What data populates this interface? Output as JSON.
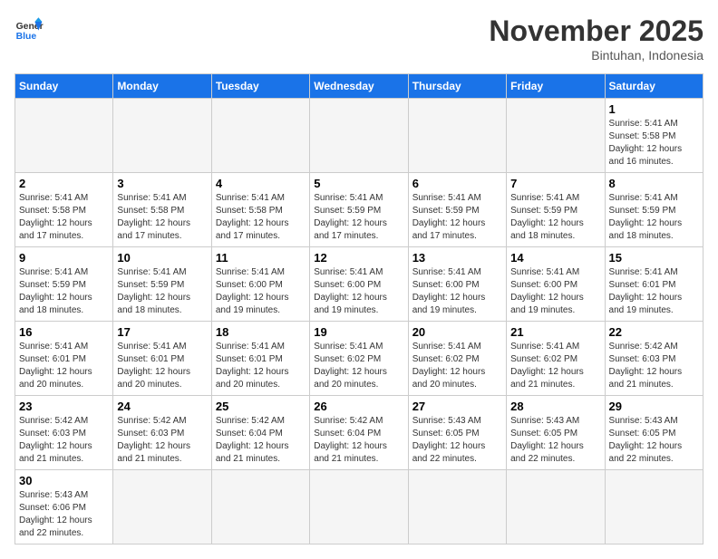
{
  "header": {
    "logo_general": "General",
    "logo_blue": "Blue",
    "month_title": "November 2025",
    "subtitle": "Bintuhan, Indonesia"
  },
  "weekdays": [
    "Sunday",
    "Monday",
    "Tuesday",
    "Wednesday",
    "Thursday",
    "Friday",
    "Saturday"
  ],
  "weeks": [
    [
      {
        "day": "",
        "info": "",
        "empty": true
      },
      {
        "day": "",
        "info": "",
        "empty": true
      },
      {
        "day": "",
        "info": "",
        "empty": true
      },
      {
        "day": "",
        "info": "",
        "empty": true
      },
      {
        "day": "",
        "info": "",
        "empty": true
      },
      {
        "day": "",
        "info": "",
        "empty": true
      },
      {
        "day": "1",
        "info": "Sunrise: 5:41 AM\nSunset: 5:58 PM\nDaylight: 12 hours and 16 minutes.",
        "empty": false
      }
    ],
    [
      {
        "day": "2",
        "info": "Sunrise: 5:41 AM\nSunset: 5:58 PM\nDaylight: 12 hours and 17 minutes.",
        "empty": false
      },
      {
        "day": "3",
        "info": "Sunrise: 5:41 AM\nSunset: 5:58 PM\nDaylight: 12 hours and 17 minutes.",
        "empty": false
      },
      {
        "day": "4",
        "info": "Sunrise: 5:41 AM\nSunset: 5:58 PM\nDaylight: 12 hours and 17 minutes.",
        "empty": false
      },
      {
        "day": "5",
        "info": "Sunrise: 5:41 AM\nSunset: 5:59 PM\nDaylight: 12 hours and 17 minutes.",
        "empty": false
      },
      {
        "day": "6",
        "info": "Sunrise: 5:41 AM\nSunset: 5:59 PM\nDaylight: 12 hours and 17 minutes.",
        "empty": false
      },
      {
        "day": "7",
        "info": "Sunrise: 5:41 AM\nSunset: 5:59 PM\nDaylight: 12 hours and 18 minutes.",
        "empty": false
      },
      {
        "day": "8",
        "info": "Sunrise: 5:41 AM\nSunset: 5:59 PM\nDaylight: 12 hours and 18 minutes.",
        "empty": false
      }
    ],
    [
      {
        "day": "9",
        "info": "Sunrise: 5:41 AM\nSunset: 5:59 PM\nDaylight: 12 hours and 18 minutes.",
        "empty": false
      },
      {
        "day": "10",
        "info": "Sunrise: 5:41 AM\nSunset: 5:59 PM\nDaylight: 12 hours and 18 minutes.",
        "empty": false
      },
      {
        "day": "11",
        "info": "Sunrise: 5:41 AM\nSunset: 6:00 PM\nDaylight: 12 hours and 19 minutes.",
        "empty": false
      },
      {
        "day": "12",
        "info": "Sunrise: 5:41 AM\nSunset: 6:00 PM\nDaylight: 12 hours and 19 minutes.",
        "empty": false
      },
      {
        "day": "13",
        "info": "Sunrise: 5:41 AM\nSunset: 6:00 PM\nDaylight: 12 hours and 19 minutes.",
        "empty": false
      },
      {
        "day": "14",
        "info": "Sunrise: 5:41 AM\nSunset: 6:00 PM\nDaylight: 12 hours and 19 minutes.",
        "empty": false
      },
      {
        "day": "15",
        "info": "Sunrise: 5:41 AM\nSunset: 6:01 PM\nDaylight: 12 hours and 19 minutes.",
        "empty": false
      }
    ],
    [
      {
        "day": "16",
        "info": "Sunrise: 5:41 AM\nSunset: 6:01 PM\nDaylight: 12 hours and 20 minutes.",
        "empty": false
      },
      {
        "day": "17",
        "info": "Sunrise: 5:41 AM\nSunset: 6:01 PM\nDaylight: 12 hours and 20 minutes.",
        "empty": false
      },
      {
        "day": "18",
        "info": "Sunrise: 5:41 AM\nSunset: 6:01 PM\nDaylight: 12 hours and 20 minutes.",
        "empty": false
      },
      {
        "day": "19",
        "info": "Sunrise: 5:41 AM\nSunset: 6:02 PM\nDaylight: 12 hours and 20 minutes.",
        "empty": false
      },
      {
        "day": "20",
        "info": "Sunrise: 5:41 AM\nSunset: 6:02 PM\nDaylight: 12 hours and 20 minutes.",
        "empty": false
      },
      {
        "day": "21",
        "info": "Sunrise: 5:41 AM\nSunset: 6:02 PM\nDaylight: 12 hours and 21 minutes.",
        "empty": false
      },
      {
        "day": "22",
        "info": "Sunrise: 5:42 AM\nSunset: 6:03 PM\nDaylight: 12 hours and 21 minutes.",
        "empty": false
      }
    ],
    [
      {
        "day": "23",
        "info": "Sunrise: 5:42 AM\nSunset: 6:03 PM\nDaylight: 12 hours and 21 minutes.",
        "empty": false
      },
      {
        "day": "24",
        "info": "Sunrise: 5:42 AM\nSunset: 6:03 PM\nDaylight: 12 hours and 21 minutes.",
        "empty": false
      },
      {
        "day": "25",
        "info": "Sunrise: 5:42 AM\nSunset: 6:04 PM\nDaylight: 12 hours and 21 minutes.",
        "empty": false
      },
      {
        "day": "26",
        "info": "Sunrise: 5:42 AM\nSunset: 6:04 PM\nDaylight: 12 hours and 21 minutes.",
        "empty": false
      },
      {
        "day": "27",
        "info": "Sunrise: 5:43 AM\nSunset: 6:05 PM\nDaylight: 12 hours and 22 minutes.",
        "empty": false
      },
      {
        "day": "28",
        "info": "Sunrise: 5:43 AM\nSunset: 6:05 PM\nDaylight: 12 hours and 22 minutes.",
        "empty": false
      },
      {
        "day": "29",
        "info": "Sunrise: 5:43 AM\nSunset: 6:05 PM\nDaylight: 12 hours and 22 minutes.",
        "empty": false
      }
    ],
    [
      {
        "day": "30",
        "info": "Sunrise: 5:43 AM\nSunset: 6:06 PM\nDaylight: 12 hours and 22 minutes.",
        "empty": false
      },
      {
        "day": "",
        "info": "",
        "empty": true
      },
      {
        "day": "",
        "info": "",
        "empty": true
      },
      {
        "day": "",
        "info": "",
        "empty": true
      },
      {
        "day": "",
        "info": "",
        "empty": true
      },
      {
        "day": "",
        "info": "",
        "empty": true
      },
      {
        "day": "",
        "info": "",
        "empty": true
      }
    ]
  ]
}
